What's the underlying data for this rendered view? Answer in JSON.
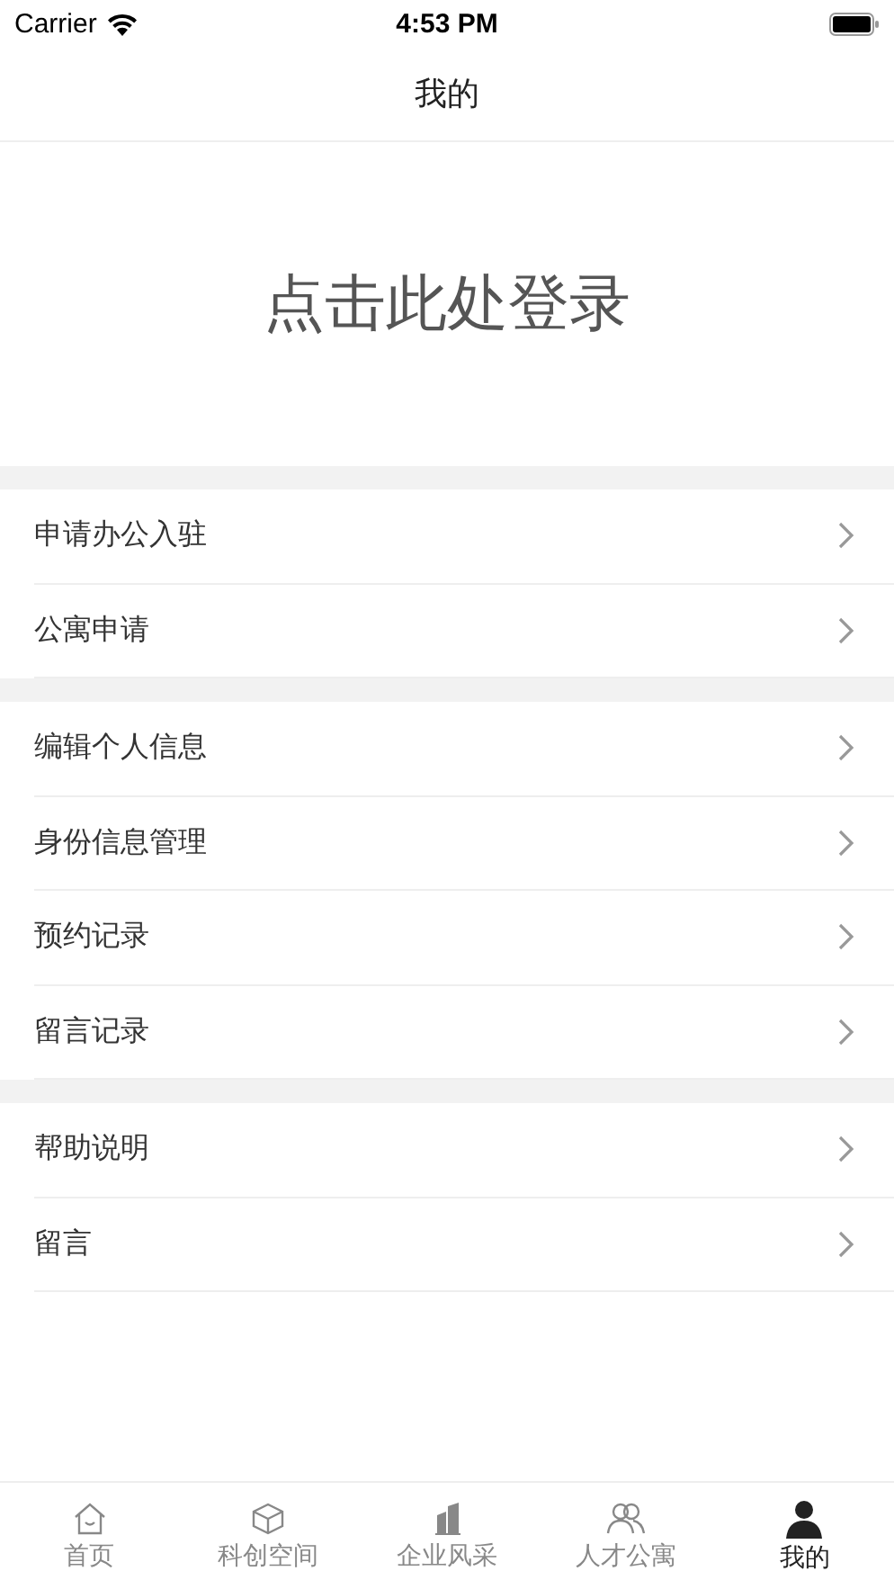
{
  "status_bar": {
    "carrier": "Carrier",
    "time": "4:53 PM"
  },
  "nav": {
    "title": "我的"
  },
  "login": {
    "label": "点击此处登录"
  },
  "menu_groups": [
    {
      "items": [
        "申请办公入驻",
        "公寓申请"
      ]
    },
    {
      "items": [
        "编辑个人信息",
        "身份信息管理",
        "预约记录",
        "留言记录"
      ]
    },
    {
      "items": [
        "帮助说明",
        "留言"
      ]
    }
  ],
  "tabs": [
    {
      "label": "首页",
      "kind": "home",
      "selected": false
    },
    {
      "label": "科创空间",
      "kind": "cube",
      "selected": false
    },
    {
      "label": "企业风采",
      "kind": "building",
      "selected": false
    },
    {
      "label": "人才公寓",
      "kind": "people",
      "selected": false
    },
    {
      "label": "我的",
      "kind": "person",
      "selected": true
    }
  ]
}
